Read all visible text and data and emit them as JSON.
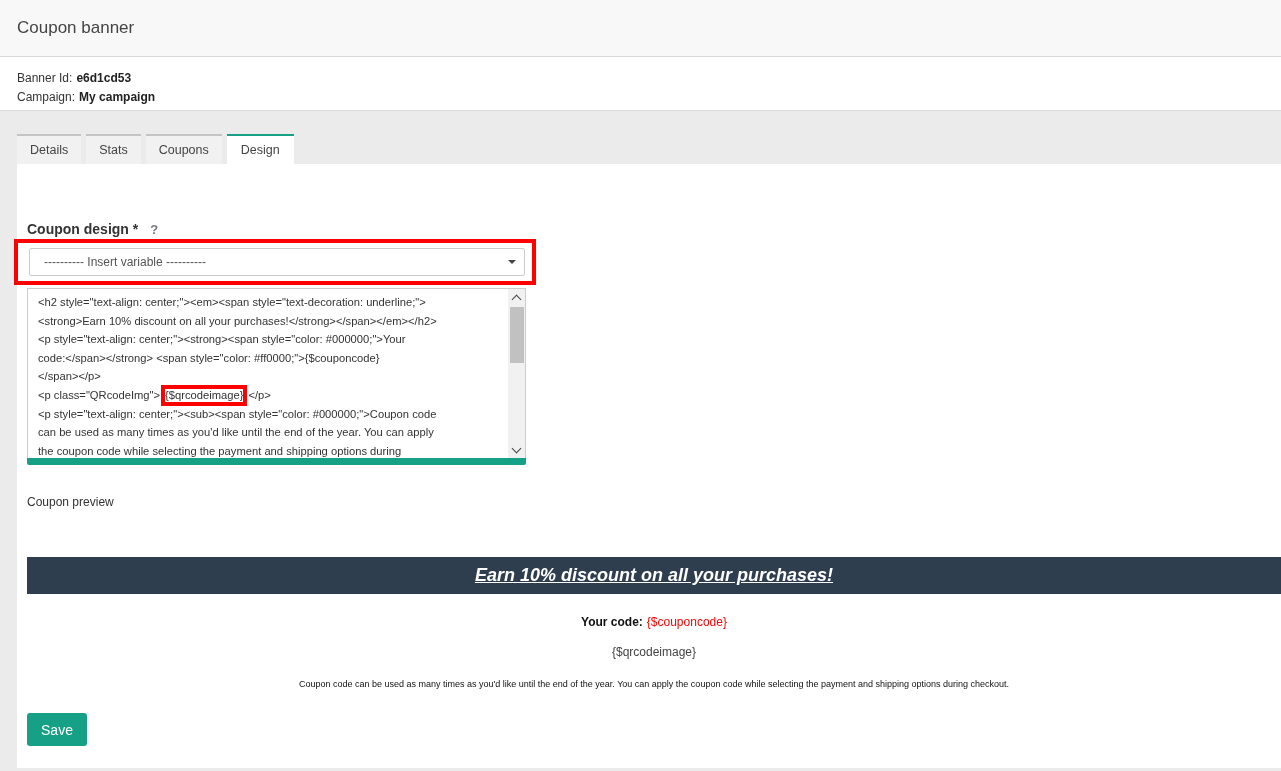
{
  "header": {
    "title": "Coupon banner"
  },
  "info": [
    {
      "label": "Banner Id:",
      "value": "e6d1cd53"
    },
    {
      "label": "Campaign:",
      "value": "My campaign"
    }
  ],
  "tabs": [
    {
      "label": "Details",
      "selected": false
    },
    {
      "label": "Stats",
      "selected": false
    },
    {
      "label": "Coupons",
      "selected": false
    },
    {
      "label": "Design",
      "selected": true
    }
  ],
  "design_field": {
    "label": "Coupon design *",
    "help": "?",
    "highlighted": true,
    "select": {
      "value": "---------- Insert variable ----------"
    },
    "editor_lines": [
      [
        {
          "text": "<h2 style=\"text-align: center;\"><em><span style=\"text-decoration: underline;\">",
          "highlighted": false
        }
      ],
      [
        {
          "text": "<strong>Earn 10% discount on all your purchases!</strong></span></em></h2>",
          "highlighted": false
        }
      ],
      [
        {
          "text": "<p style=\"text-align: center;\"><strong><span style=\"color: #000000;\">Your",
          "highlighted": false
        }
      ],
      [
        {
          "text": "code:</span></strong> <span style=\"color: #ff0000;\">{$couponcode}",
          "highlighted": false
        }
      ],
      [
        {
          "text": "</span></p>",
          "highlighted": false
        }
      ],
      [
        {
          "text": "<p class=\"QRcodeImg\">",
          "highlighted": false
        },
        {
          "text": "{$qrcodeimage}",
          "highlighted": true
        },
        {
          "text": "</p>",
          "highlighted": false
        }
      ],
      [
        {
          "text": "<p style=\"text-align: center;\"><sub><span style=\"color: #000000;\">Coupon code",
          "highlighted": false
        }
      ],
      [
        {
          "text": "can be used as many times as you'd like until the end of the year. You can apply",
          "highlighted": false
        }
      ],
      [
        {
          "text": "the coupon code while selecting the payment and shipping options during",
          "highlighted": false
        }
      ]
    ]
  },
  "preview": {
    "label": "Coupon preview",
    "heading": "Earn 10% discount on all your purchases!",
    "code_label": "Your code:",
    "code_value": "{$couponcode}",
    "qr": "{$qrcodeimage}",
    "note": "Coupon code can be used as many times as you'd like until the end of the year. You can apply the coupon code while selecting the payment and shipping options during checkout."
  },
  "save_button": "Save"
}
